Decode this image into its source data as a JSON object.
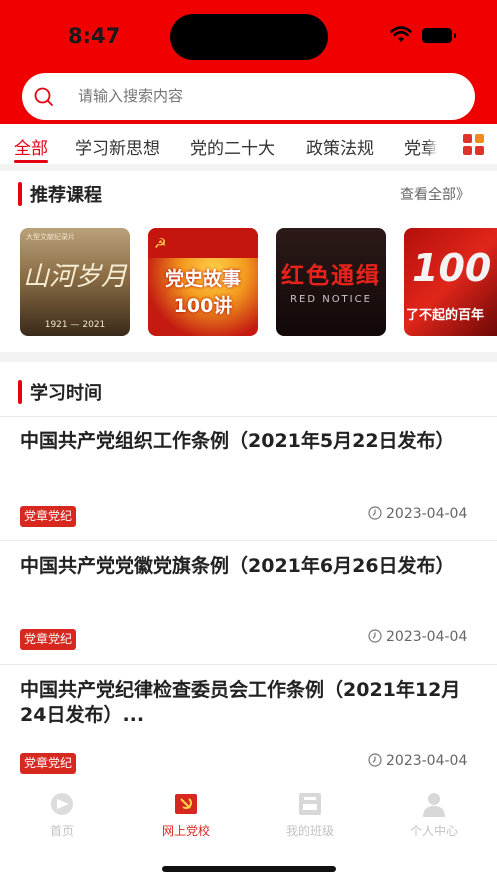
{
  "status_bar": {
    "time": "8:47"
  },
  "search": {
    "placeholder": "请输入搜索内容"
  },
  "tabs": [
    {
      "label": "全部",
      "active": true
    },
    {
      "label": "学习新思想"
    },
    {
      "label": "党的二十大"
    },
    {
      "label": "政策法规"
    },
    {
      "label": "党章党"
    }
  ],
  "recommended": {
    "title": "推荐课程",
    "view_all": "查看全部》",
    "courses": [
      {
        "title": "山河岁月",
        "caption": "1921 — 2021",
        "kicker": "大型文献纪录片"
      },
      {
        "title": "党史故事100讲"
      },
      {
        "title": "红色通缉",
        "subtitle": "RED NOTICE"
      },
      {
        "title": "100",
        "subtitle": "了不起的百年"
      }
    ]
  },
  "study_time": {
    "title": "学习时间",
    "articles": [
      {
        "title": "中国共产党组织工作条例（2021年5月22日发布）",
        "tag": "党章党纪",
        "date": "2023-04-04"
      },
      {
        "title": "中国共产党党徽党旗条例（2021年6月26日发布）",
        "tag": "党章党纪",
        "date": "2023-04-04"
      },
      {
        "title": "中国共产党纪律检查委员会工作条例（2021年12月24日发布）...",
        "tag": "党章党纪",
        "date": "2023-04-04"
      }
    ]
  },
  "bottom_nav": [
    {
      "label": "首页",
      "icon": "home-icon"
    },
    {
      "label": "网上党校",
      "icon": "party-school-icon",
      "active": true
    },
    {
      "label": "我的班级",
      "icon": "class-icon"
    },
    {
      "label": "个人中心",
      "icon": "profile-icon"
    }
  ],
  "colors": {
    "brand_red": "#f00000",
    "accent_red": "#e60012",
    "tag_red": "#d6281f"
  }
}
